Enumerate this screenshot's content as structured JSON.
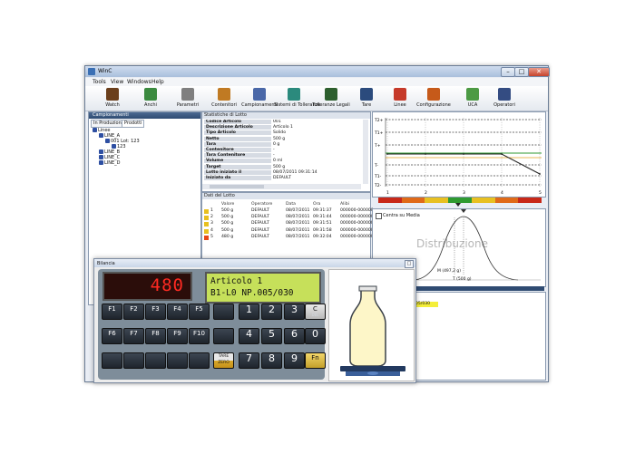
{
  "window": {
    "title": "WinC",
    "controls": {
      "minimize": "–",
      "maximize": "□",
      "close": "✕"
    }
  },
  "menu": [
    "Tools",
    "View",
    "Windows",
    "Help"
  ],
  "toolbar": [
    {
      "label": "Watch",
      "icon": "chart-icon",
      "color": "#6b3f1c"
    },
    {
      "label": "Anchi",
      "icon": "spheres-icon",
      "color": "#3b8a3f"
    },
    {
      "label": "Parametri",
      "icon": "wrench-icon",
      "color": "#7f7f7f"
    },
    {
      "label": "Contenitori",
      "icon": "box-icon",
      "color": "#c07a23"
    },
    {
      "label": "Campionamenti",
      "icon": "bar-icon",
      "color": "#4a68a8"
    },
    {
      "label": "Sistemi di Tolleranze",
      "icon": "globe-icon",
      "color": "#2b8a7d"
    },
    {
      "label": "Tolleranze Legali",
      "icon": "cube-icon",
      "color": "#2d5f2e"
    },
    {
      "label": "Tare",
      "icon": "tare-icon",
      "color": "#2b4b7d"
    },
    {
      "label": "Linee",
      "icon": "line-icon",
      "color": "#c63a2a"
    },
    {
      "label": "Configurazione",
      "icon": "gear-box-icon",
      "color": "#c65a1a"
    },
    {
      "label": "UCA",
      "icon": "clipboard-icon",
      "color": "#4c9a44"
    },
    {
      "label": "Operatori",
      "icon": "users-icon",
      "color": "#344c82"
    }
  ],
  "left_panel": {
    "header": "Campionamenti",
    "tabs": [
      "In Produzione",
      "Prodotti"
    ],
    "tree": [
      {
        "label": "Linee",
        "level": 0
      },
      {
        "label": "LINE_A",
        "level": 1
      },
      {
        "label": "001   Lot: 123",
        "level": 2
      },
      {
        "label": "123",
        "level": 3
      },
      {
        "label": "LINE_B",
        "level": 1
      },
      {
        "label": "LINE_C",
        "level": 1
      },
      {
        "label": "LINE_D",
        "level": 1
      }
    ]
  },
  "stats_panel": {
    "header": "Statistiche di Lotto",
    "rows": [
      {
        "k": "Codice Articolo",
        "v": "001"
      },
      {
        "k": "Descrizione Articolo",
        "v": "Articolo 1"
      },
      {
        "k": "Tipo Articolo",
        "v": "Solido"
      },
      {
        "k": "Netto",
        "v": "500 g"
      },
      {
        "k": "Tara",
        "v": "0 g"
      },
      {
        "k": "Contenitore",
        "v": "-"
      },
      {
        "k": "Tara Contenitore",
        "v": "-"
      },
      {
        "k": "Volume",
        "v": "0 ml"
      },
      {
        "k": "Target",
        "v": "500 g"
      },
      {
        "k": "Lotto iniziato il",
        "v": "08/07/2011 09:31:14"
      },
      {
        "k": "Iniziato da",
        "v": "DEFAULT"
      }
    ]
  },
  "grid_panel": {
    "header": "Dati del Lotto",
    "columns": [
      "Valore",
      "Operatore",
      "Data",
      "Ora",
      "Alibi"
    ],
    "rows": [
      {
        "n": "1",
        "valore": "500 g",
        "op": "DEFAULT",
        "data": "08/07/2011",
        "ora": "09:31:37",
        "alibi": "000000-000000",
        "mark": "#e8c020"
      },
      {
        "n": "2",
        "valore": "500 g",
        "op": "DEFAULT",
        "data": "08/07/2011",
        "ora": "09:31:44",
        "alibi": "000000-000000",
        "mark": "#e8c020"
      },
      {
        "n": "3",
        "valore": "500 g",
        "op": "DEFAULT",
        "data": "08/07/2011",
        "ora": "09:31:51",
        "alibi": "000000-000000",
        "mark": "#e8c020"
      },
      {
        "n": "4",
        "valore": "500 g",
        "op": "DEFAULT",
        "data": "08/07/2011",
        "ora": "09:31:58",
        "alibi": "000000-000000",
        "mark": "#e8c020"
      },
      {
        "n": "5",
        "valore": "480 g",
        "op": "DEFAULT",
        "data": "08/07/2011",
        "ora": "09:32:04",
        "alibi": "000000-000000",
        "mark": "#e84818"
      }
    ]
  },
  "trend_chart": {
    "y_labels": [
      "T2+",
      "T1+",
      "T+",
      "T-",
      "T1-",
      "T2-"
    ],
    "x_labels": [
      "1",
      "2",
      "3",
      "4",
      "5"
    ],
    "values": [
      500,
      500,
      500,
      500,
      480
    ],
    "color_bar": [
      "#c82818",
      "#e06a18",
      "#e8c020",
      "#2e9a30",
      "#e8c020",
      "#e06a18",
      "#c82818"
    ]
  },
  "distribution": {
    "checkbox_label": "Centra su Media",
    "title": "Distribuzione",
    "mean_label": "M (497,2 g)",
    "target_label": "T (500 g)"
  },
  "bottom_strip": {
    "value": "005/030"
  },
  "bilancia": {
    "title": "Bilancia",
    "display": "480",
    "lcd_line1": "Articolo 1",
    "lcd_line2": "B1-L0 NP.005/030",
    "keys": [
      {
        "a": "F1",
        "b": "",
        "t": "dark"
      },
      {
        "a": "F2",
        "b": "",
        "t": "dark"
      },
      {
        "a": "F3",
        "b": "",
        "t": "dark"
      },
      {
        "a": "F4",
        "b": "",
        "t": "dark"
      },
      {
        "a": "F5",
        "b": "",
        "t": "dark"
      },
      {
        "a": "",
        "b": "",
        "t": "dark"
      },
      {
        "a": "1",
        "b": "",
        "t": "num"
      },
      {
        "a": "2",
        "b": "",
        "t": "num"
      },
      {
        "a": "3",
        "b": "",
        "t": "num"
      },
      {
        "a": "C",
        "b": "DEL",
        "t": "gray"
      },
      {
        "a": "F6",
        "b": "",
        "t": "dark"
      },
      {
        "a": "F7",
        "b": "",
        "t": "dark"
      },
      {
        "a": "F8",
        "b": "",
        "t": "dark"
      },
      {
        "a": "F9",
        "b": "",
        "t": "dark"
      },
      {
        "a": "F10",
        "b": "",
        "t": "dark"
      },
      {
        "a": "",
        "b": "",
        "t": "dark"
      },
      {
        "a": "4",
        "b": "",
        "t": "num"
      },
      {
        "a": "5",
        "b": "",
        "t": "num"
      },
      {
        "a": "6",
        "b": "",
        "t": "num"
      },
      {
        "a": "0",
        "b": "",
        "t": "num"
      },
      {
        "a": "",
        "b": "",
        "t": "dark"
      },
      {
        "a": "",
        "b": "",
        "t": "dark"
      },
      {
        "a": "",
        "b": "",
        "t": "dark"
      },
      {
        "a": "",
        "b": "",
        "t": "dark"
      },
      {
        "a": "",
        "b": "",
        "t": "dark"
      },
      {
        "a": "TARE",
        "b": "ZERO",
        "t": "tare"
      },
      {
        "a": "7",
        "b": "",
        "t": "num"
      },
      {
        "a": "8",
        "b": "",
        "t": "num"
      },
      {
        "a": "9",
        "b": "",
        "t": "num"
      },
      {
        "a": "Fn",
        "b": "",
        "t": "yel"
      }
    ]
  }
}
